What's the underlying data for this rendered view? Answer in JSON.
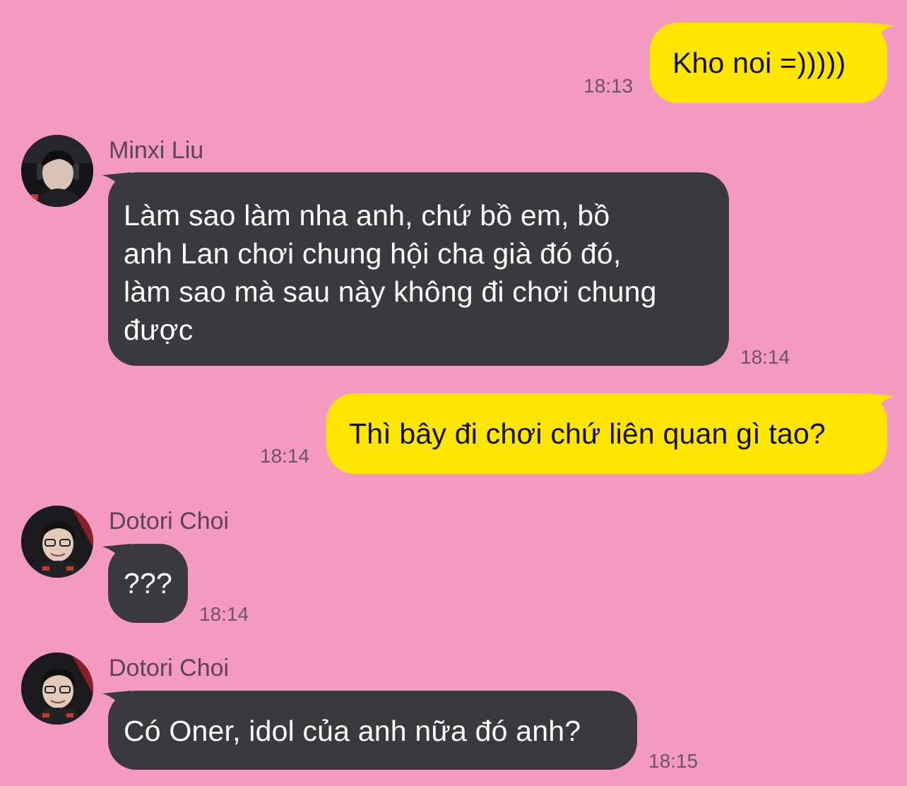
{
  "colors": {
    "background": "#f49ac1",
    "outgoing_bubble": "#ffe500",
    "incoming_bubble": "#3a3a3c",
    "timestamp": "#6b5560",
    "sender_name": "#5a4650"
  },
  "messages": [
    {
      "direction": "outgoing",
      "text": "Kho noi =)))))",
      "time": "18:13"
    },
    {
      "direction": "incoming",
      "sender": "Minxi Liu",
      "avatar": "user-avatar-icon",
      "text_lines": [
        "Làm sao làm nha anh, chứ bồ em, bồ",
        "anh Lan chơi chung hội cha già đó đó,",
        "làm sao mà sau này không đi chơi chung",
        "được"
      ],
      "time": "18:14"
    },
    {
      "direction": "outgoing",
      "text": "Thì bây đi chơi chứ liên quan gì tao?",
      "time": "18:14"
    },
    {
      "direction": "incoming",
      "sender": "Dotori Choi",
      "avatar": "user-avatar-icon",
      "text": "???",
      "time": "18:14"
    },
    {
      "direction": "incoming",
      "sender": "Dotori Choi",
      "avatar": "user-avatar-icon",
      "text": "Có Oner, idol của anh nữa đó anh?",
      "time": "18:15"
    }
  ]
}
